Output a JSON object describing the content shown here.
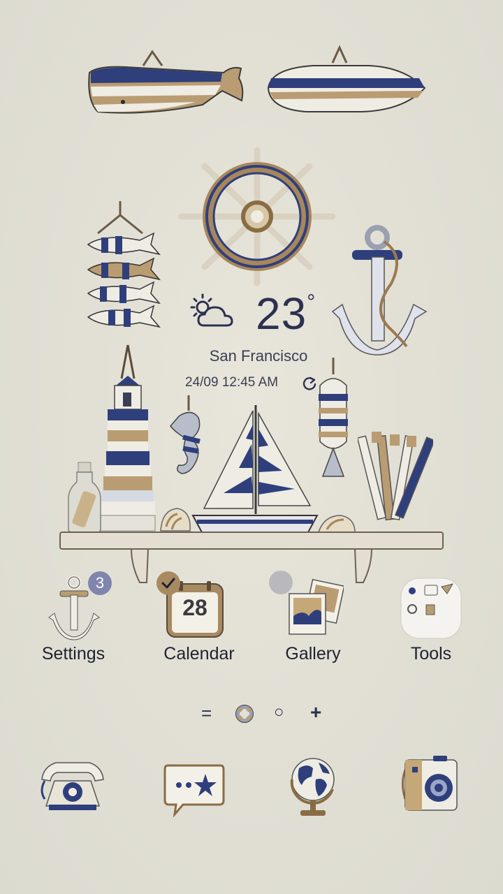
{
  "weather": {
    "temperature": "23",
    "degree_symbol": "°",
    "city": "San Francisco",
    "datetime": "24/09 12:45 AM",
    "condition_icon": "partly-cloudy-icon",
    "refresh_icon": "refresh-icon"
  },
  "apps": [
    {
      "label": "Settings",
      "icon": "anchor-settings-icon",
      "badge": "3"
    },
    {
      "label": "Calendar",
      "icon": "calendar-icon",
      "date": "28"
    },
    {
      "label": "Gallery",
      "icon": "gallery-photos-icon"
    },
    {
      "label": "Tools",
      "icon": "tools-folder-icon"
    }
  ],
  "page_indicators": [
    {
      "symbol": "=",
      "name": "menu-indicator"
    },
    {
      "symbol": "",
      "name": "lifebuoy-home-indicator"
    },
    {
      "symbol": "○",
      "name": "page-dot"
    },
    {
      "symbol": "+",
      "name": "add-page-indicator"
    }
  ],
  "dock": [
    {
      "icon": "phone-icon"
    },
    {
      "icon": "messages-icon"
    },
    {
      "icon": "internet-globe-icon"
    },
    {
      "icon": "camera-icon"
    }
  ],
  "colors": {
    "navy": "#2f3f7c",
    "cream": "#efece4",
    "tan": "#b99c72",
    "background": "#e2e0d5",
    "badge": "#7f85ad"
  }
}
